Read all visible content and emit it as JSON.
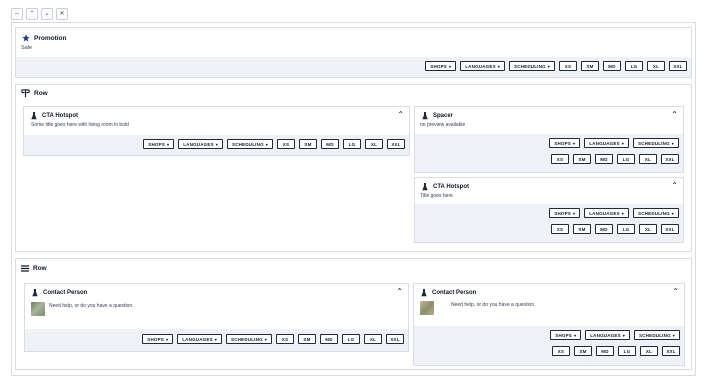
{
  "toolbar": {
    "buttons": [
      {
        "name": "expand-horizontal-button",
        "glyph": "⇔"
      },
      {
        "name": "move-up-button",
        "glyph": "⌃"
      },
      {
        "name": "move-down-button",
        "glyph": "⌄"
      },
      {
        "name": "close-button",
        "glyph": "✕"
      }
    ]
  },
  "controls": {
    "shops": "SHOPS",
    "languages": "LANGUAGES",
    "scheduling": "SCHEDULING",
    "breakpoints": [
      "XS",
      "SM",
      "MD",
      "LG",
      "XL",
      "XXL"
    ],
    "caret": "▾"
  },
  "promotion": {
    "title": "Promotion",
    "subtitle": "Sale",
    "icon": "star-icon"
  },
  "row1": {
    "title": "Row",
    "icon": "columns-icon",
    "cta1": {
      "title": "CTA Hotspot",
      "desc": "Some title goes here with living room in bold"
    },
    "spacer": {
      "title": "Spacer",
      "desc": "no preview available"
    },
    "cta2": {
      "title": "CTA Hotspot",
      "desc": "Title goes here"
    }
  },
  "row2": {
    "title": "Row",
    "icon": "rows-icon",
    "contact1": {
      "title": "Contact Person",
      "desc": "Need help, or do you have a question."
    },
    "contact2": {
      "title": "Contact Person",
      "desc": "Need help, or do you have a question."
    }
  },
  "colors": {
    "footer_bg": "#eef1f6",
    "border": "#d9dde3",
    "text": "#111827"
  }
}
